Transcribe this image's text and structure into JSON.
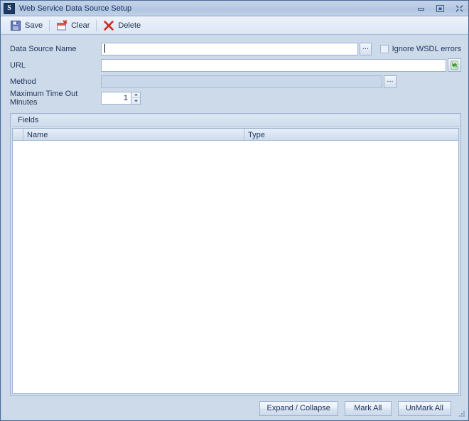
{
  "window": {
    "title": "Web Service Data Source Setup",
    "app_icon": "app-icon",
    "controls": {
      "minimize": "minimize-icon",
      "maximize": "maximize-icon",
      "close": "close-icon"
    }
  },
  "toolbar": {
    "items": [
      {
        "label": "Save",
        "icon": "save-icon"
      },
      {
        "label": "Clear",
        "icon": "clear-icon"
      },
      {
        "label": "Delete",
        "icon": "delete-icon"
      }
    ]
  },
  "form": {
    "data_source_name": {
      "label": "Data Source Name",
      "value": "",
      "placeholder": "",
      "browse_label": "..."
    },
    "ignore_wsdl_errors": {
      "label": "Ignore WSDL errors",
      "checked": false
    },
    "url": {
      "label": "URL",
      "value": "",
      "placeholder": "",
      "refresh_icon": "refresh-icon"
    },
    "method": {
      "label": "Method",
      "value": "",
      "placeholder": "",
      "disabled": true,
      "browse_label": "..."
    },
    "max_timeout": {
      "label": "Maximum Time Out Minutes",
      "value": "1"
    }
  },
  "fields_group": {
    "title": "Fields",
    "columns": [
      "",
      "Name",
      "Type"
    ],
    "rows": []
  },
  "footer": {
    "buttons": [
      {
        "label": "Expand / Collapse"
      },
      {
        "label": "Mark All"
      },
      {
        "label": "UnMark All"
      }
    ]
  },
  "colors": {
    "window_bg": "#ccdaea",
    "titlebar": "#b9cae3",
    "border": "#4a6a96",
    "text": "#21365a",
    "field_border": "#9bb2cf",
    "delete_red": "#d02b1e",
    "refresh_green": "#3f9e36"
  }
}
